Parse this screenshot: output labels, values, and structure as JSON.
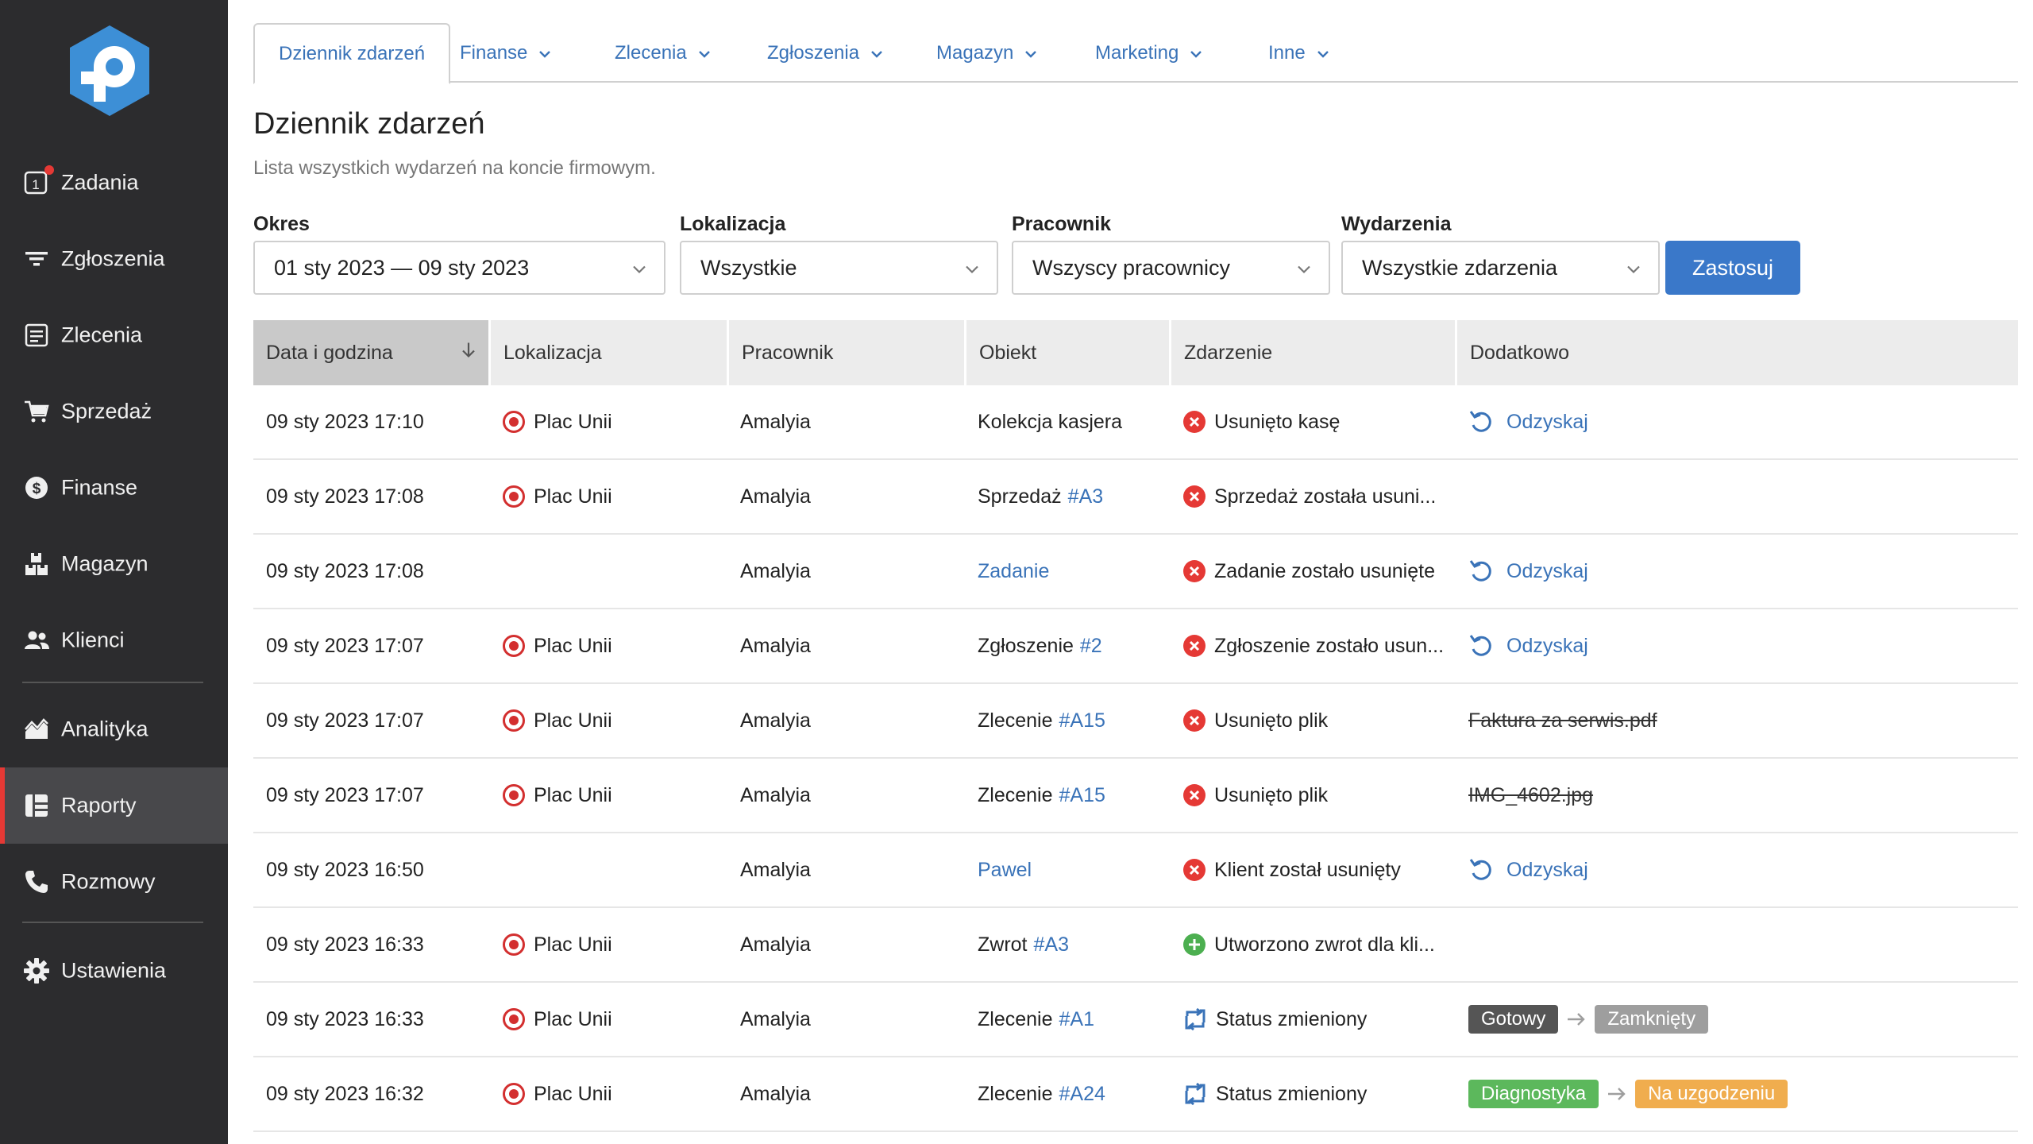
{
  "sidebar": {
    "items": [
      {
        "label": "Zadania",
        "icon": "tasks-icon"
      },
      {
        "label": "Zgłoszenia",
        "icon": "filter-lines-icon"
      },
      {
        "label": "Zlecenia",
        "icon": "document-icon"
      },
      {
        "label": "Sprzedaż",
        "icon": "cart-icon"
      },
      {
        "label": "Finanse",
        "icon": "dollar-icon"
      },
      {
        "label": "Magazyn",
        "icon": "boxes-icon"
      },
      {
        "label": "Klienci",
        "icon": "users-icon"
      },
      {
        "label": "Analityka",
        "icon": "chart-area-icon"
      },
      {
        "label": "Raporty",
        "icon": "reports-icon"
      },
      {
        "label": "Rozmowy",
        "icon": "phone-icon"
      },
      {
        "label": "Ustawienia",
        "icon": "gear-icon"
      }
    ],
    "tasks_badge_number": "1",
    "active_item": "Raporty"
  },
  "tabs": [
    {
      "label": "Dziennik zdarzeń"
    },
    {
      "label": "Finanse"
    },
    {
      "label": "Zlecenia"
    },
    {
      "label": "Zgłoszenia"
    },
    {
      "label": "Magazyn"
    },
    {
      "label": "Marketing"
    },
    {
      "label": "Inne"
    }
  ],
  "page": {
    "title": "Dziennik zdarzeń",
    "subtitle": "Lista wszystkich wydarzeń na koncie firmowym."
  },
  "filters": {
    "period": {
      "label": "Okres",
      "value": "01 sty 2023 — 09 sty 2023"
    },
    "location": {
      "label": "Lokalizacja",
      "value": "Wszystkie"
    },
    "employee": {
      "label": "Pracownik",
      "value": "Wszyscy pracownicy"
    },
    "events": {
      "label": "Wydarzenia",
      "value": "Wszystkie zdarzenia"
    },
    "apply_label": "Zastosuj"
  },
  "table": {
    "headers": [
      "Data i godzina",
      "Lokalizacja",
      "Pracownik",
      "Obiekt",
      "Zdarzenie",
      "Dodatkowo"
    ],
    "rows": [
      {
        "date": "09 sty 2023 17:10",
        "location": "Plac Unii",
        "employee": "Amalyia",
        "object_text": "Kolekcja kasjera",
        "object_link": "",
        "event_type": "removed",
        "event": "Usunięto kasę",
        "extra_type": "recover",
        "extra": "Odzyskaj"
      },
      {
        "date": "09 sty 2023 17:08",
        "location": "Plac Unii",
        "employee": "Amalyia",
        "object_text": "Sprzedaż",
        "object_link": "#A3",
        "event_type": "removed",
        "event": "Sprzedaż została usuni...",
        "extra_type": "none",
        "extra": ""
      },
      {
        "date": "09 sty 2023 17:08",
        "location": "",
        "employee": "Amalyia",
        "object_text": "",
        "object_link": "Zadanie",
        "event_type": "removed",
        "event": "Zadanie zostało usunięte",
        "extra_type": "recover",
        "extra": "Odzyskaj"
      },
      {
        "date": "09 sty 2023 17:07",
        "location": "Plac Unii",
        "employee": "Amalyia",
        "object_text": "Zgłoszenie",
        "object_link": "#2",
        "event_type": "removed",
        "event": "Zgłoszenie zostało usun...",
        "extra_type": "recover",
        "extra": "Odzyskaj"
      },
      {
        "date": "09 sty 2023 17:07",
        "location": "Plac Unii",
        "employee": "Amalyia",
        "object_text": "Zlecenie",
        "object_link": "#A15",
        "event_type": "removed",
        "event": "Usunięto plik",
        "extra_type": "strike",
        "extra": "Faktura za serwis.pdf"
      },
      {
        "date": "09 sty 2023 17:07",
        "location": "Plac Unii",
        "employee": "Amalyia",
        "object_text": "Zlecenie",
        "object_link": "#A15",
        "event_type": "removed",
        "event": "Usunięto plik",
        "extra_type": "strike",
        "extra": "IMG_4602.jpg"
      },
      {
        "date": "09 sty 2023 16:50",
        "location": "",
        "employee": "Amalyia",
        "object_text": "",
        "object_link": "Pawel",
        "event_type": "removed",
        "event": "Klient został usunięty",
        "extra_type": "recover",
        "extra": "Odzyskaj"
      },
      {
        "date": "09 sty 2023 16:33",
        "location": "Plac Unii",
        "employee": "Amalyia",
        "object_text": "Zwrot",
        "object_link": "#A3",
        "event_type": "added",
        "event": "Utworzono zwrot dla kli...",
        "extra_type": "none",
        "extra": ""
      },
      {
        "date": "09 sty 2023 16:33",
        "location": "Plac Unii",
        "employee": "Amalyia",
        "object_text": "Zlecenie",
        "object_link": "#A1",
        "event_type": "status",
        "event": "Status zmieniony",
        "extra_type": "status",
        "extra": "",
        "from": {
          "label": "Gotowy",
          "color": "#555555"
        },
        "to": {
          "label": "Zamknięty",
          "color": "#9e9e9e"
        }
      },
      {
        "date": "09 sty 2023 16:32",
        "location": "Plac Unii",
        "employee": "Amalyia",
        "object_text": "Zlecenie",
        "object_link": "#A24",
        "event_type": "status",
        "event": "Status zmieniony",
        "extra_type": "status",
        "extra": "",
        "from": {
          "label": "Diagnostyka",
          "color": "#5cb85c"
        },
        "to": {
          "label": "Na uzgodzeniu",
          "color": "#f0ad4e"
        }
      }
    ]
  },
  "colors": {
    "sidebar_bg": "#2c2c2e",
    "accent_blue": "#3a78c9",
    "link_blue": "#3a73b8",
    "danger_red": "#e53935",
    "success_green": "#4caf50",
    "logo_blue": "#3d8fd6"
  }
}
